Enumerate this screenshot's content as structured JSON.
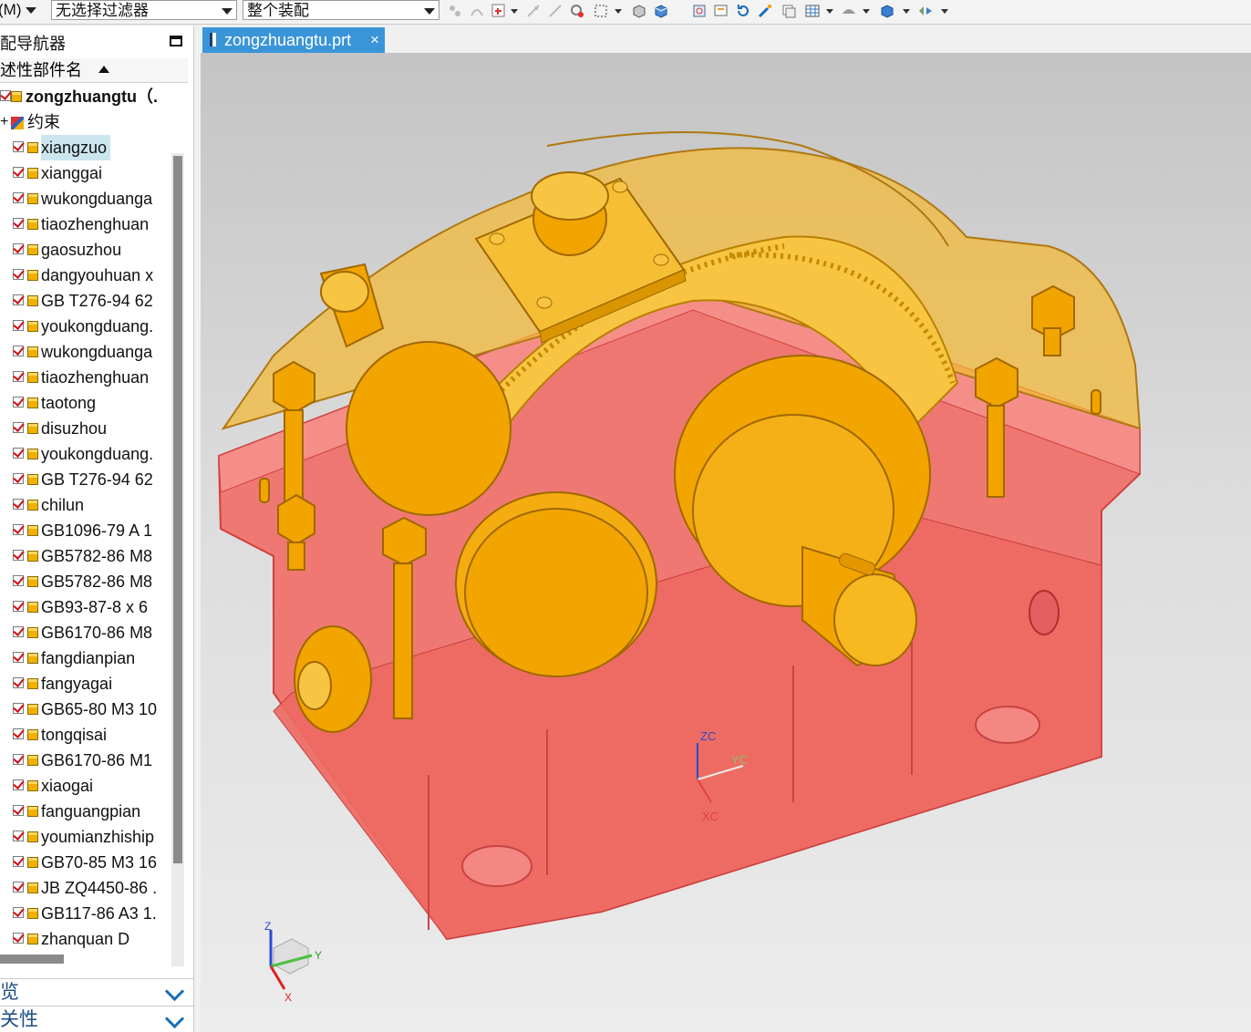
{
  "toolbar": {
    "menu_label": "(M)",
    "filter_label": "无选择过滤器",
    "scope_label": "整个装配"
  },
  "navigator": {
    "title": "配导航器",
    "column_header": "述性部件名",
    "root": "zongzhuangtu（.",
    "constraint_label": "约束",
    "items": [
      "xiangzuo",
      "xianggai",
      "wukongduanga",
      "tiaozhenghuan",
      "gaosuzhou",
      "dangyouhuan x",
      "GB T276-94  62",
      "youkongduang.",
      "wukongduanga",
      "tiaozhenghuan",
      "taotong",
      "disuzhou",
      "youkongduang.",
      "GB T276-94  62",
      "chilun",
      "GB1096-79  A 1",
      "GB5782-86 M8",
      "GB5782-86  M8",
      "GB93-87-8 x 6",
      "GB6170-86  M8",
      "fangdianpian",
      "fangyagai",
      "GB65-80 M3 10",
      "tongqisai",
      "GB6170-86  M1",
      "xiaogai",
      "fanguangpian",
      "youmianzhiship",
      "GB70-85 M3 16",
      "JB ZQ4450-86  .",
      "GB117-86 A3 1.",
      "zhanquan   D"
    ],
    "selected_index": 0
  },
  "sections": {
    "preview": "览",
    "properties": "关性"
  },
  "tab": {
    "filename": "zongzhuangtu.prt",
    "close": "×"
  },
  "triad": {
    "wcs_z": "ZC",
    "wcs_y": "YC",
    "wcs_x": "XC",
    "abs_z": "Z",
    "abs_y": "Y",
    "abs_x": "X"
  },
  "colors": {
    "housing_lower": "#f07068",
    "housing_upper": "#f3b93a",
    "parts": "#f2a400",
    "tab_active": "#3a95d8",
    "selection": "#cbe6ee"
  }
}
